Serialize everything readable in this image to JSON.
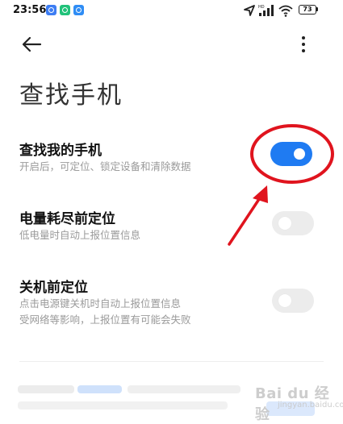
{
  "status_bar": {
    "time": "23:56",
    "battery": "73"
  },
  "header": {
    "title": "查找手机"
  },
  "settings": [
    {
      "title": "查找我的手机",
      "subtitle": [
        "开启后，可定位、锁定设备和清除数据"
      ],
      "enabled": true
    },
    {
      "title": "电量耗尽前定位",
      "subtitle": [
        "低电量时自动上报位置信息"
      ],
      "enabled": false
    },
    {
      "title": "关机前定位",
      "subtitle": [
        "点击电源键关机时自动上报位置信息",
        "受网络等影响，上报位置有可能会失败"
      ],
      "enabled": false
    }
  ],
  "annotation": {
    "color": "#e0141e"
  },
  "watermark": {
    "text": "Bai du 经验",
    "sub": "jingyan.baidu.com"
  },
  "colors": {
    "accent": "#1f7bf2",
    "toggle_off": "#ececec"
  }
}
